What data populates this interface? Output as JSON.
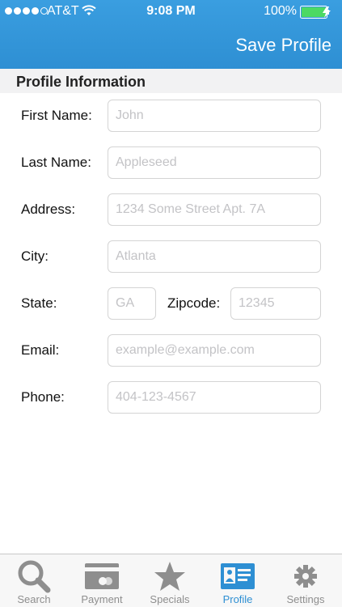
{
  "status_bar": {
    "carrier": "AT&T",
    "time": "9:08 PM",
    "battery_percent": "100%"
  },
  "header": {
    "save_label": "Save Profile"
  },
  "section": {
    "title": "Profile Information"
  },
  "form": {
    "first_name": {
      "label": "First Name:",
      "value": "",
      "placeholder": "John"
    },
    "last_name": {
      "label": "Last Name:",
      "value": "",
      "placeholder": "Appleseed"
    },
    "address": {
      "label": "Address:",
      "value": "",
      "placeholder": "1234 Some Street Apt. 7A"
    },
    "city": {
      "label": "City:",
      "value": "",
      "placeholder": "Atlanta"
    },
    "state": {
      "label": "State:",
      "value": "",
      "placeholder": "GA"
    },
    "zipcode": {
      "label": "Zipcode:",
      "value": "",
      "placeholder": "12345"
    },
    "email": {
      "label": "Email:",
      "value": "",
      "placeholder": "example@example.com"
    },
    "phone": {
      "label": "Phone:",
      "value": "",
      "placeholder": "404-123-4567"
    }
  },
  "tab_bar": {
    "items": [
      {
        "label": "Search",
        "icon": "search-icon",
        "active": false
      },
      {
        "label": "Payment",
        "icon": "payment-icon",
        "active": false
      },
      {
        "label": "Specials",
        "icon": "star-icon",
        "active": false
      },
      {
        "label": "Profile",
        "icon": "profile-card-icon",
        "active": true
      },
      {
        "label": "Settings",
        "icon": "gear-icon",
        "active": false
      }
    ]
  },
  "colors": {
    "header_blue": "#2e8fd3",
    "active_tab": "#2e8fd3",
    "inactive_tab": "#8e8e8e",
    "battery_green": "#4cd964"
  }
}
